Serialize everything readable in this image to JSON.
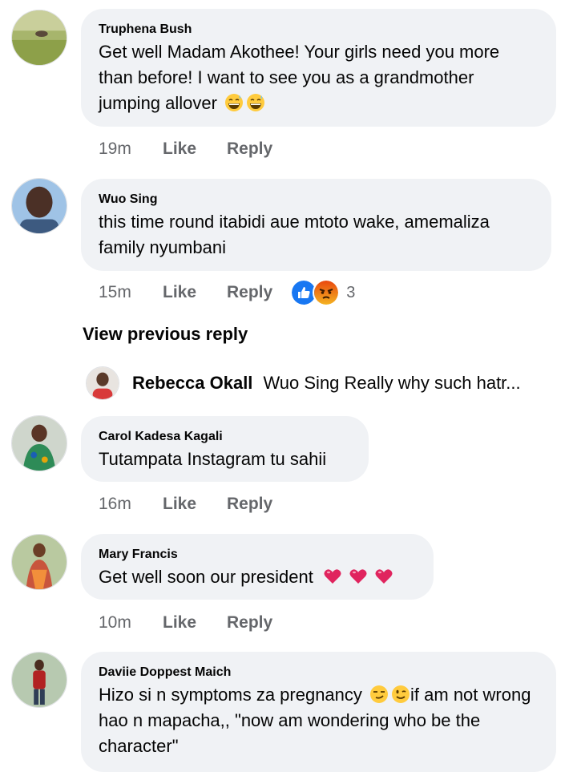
{
  "comments": [
    {
      "author": "Truphena Bush",
      "text": "Get well Madam Akothee! Your girls need you more than before! I want to see you as a grandmother jumping allover",
      "emoji": [
        "😅",
        "😅"
      ],
      "time": "19m",
      "like": "Like",
      "reply": "Reply"
    },
    {
      "author": "Wuo Sing",
      "text": "this time round itabidi aue mtoto wake, amemaliza family nyumbani",
      "time": "15m",
      "like": "Like",
      "reply": "Reply",
      "reactions": {
        "icons": [
          "like-reaction",
          "angry-reaction"
        ],
        "count": "3"
      }
    },
    {
      "author": "Carol Kadesa Kagali",
      "text": "Tutampata Instagram tu sahii",
      "time": "16m",
      "like": "Like",
      "reply": "Reply"
    },
    {
      "author": "Mary Francis",
      "text": "Get well soon our president",
      "emoji": [
        "❤️",
        "❤️",
        "❤️"
      ],
      "time": "10m",
      "like": "Like",
      "reply": "Reply"
    },
    {
      "author": "Daviie Doppest Maich",
      "text_part1": "Hizo si n symptoms za pregnancy",
      "emoji": [
        "😏",
        "😉"
      ],
      "text_part2": "if am not wrong hao n mapacha,, \"now am wondering who be the character\""
    }
  ],
  "view_previous": "View previous reply",
  "nested_reply": {
    "author": "Rebecca Okall",
    "text": "Wuo Sing Really why such hatr..."
  },
  "colors": {
    "bubble": "#f0f2f5",
    "meta": "#65676b",
    "like_blue": "#1877f2",
    "angry": "#e9710f",
    "heart": "#e0245e"
  }
}
